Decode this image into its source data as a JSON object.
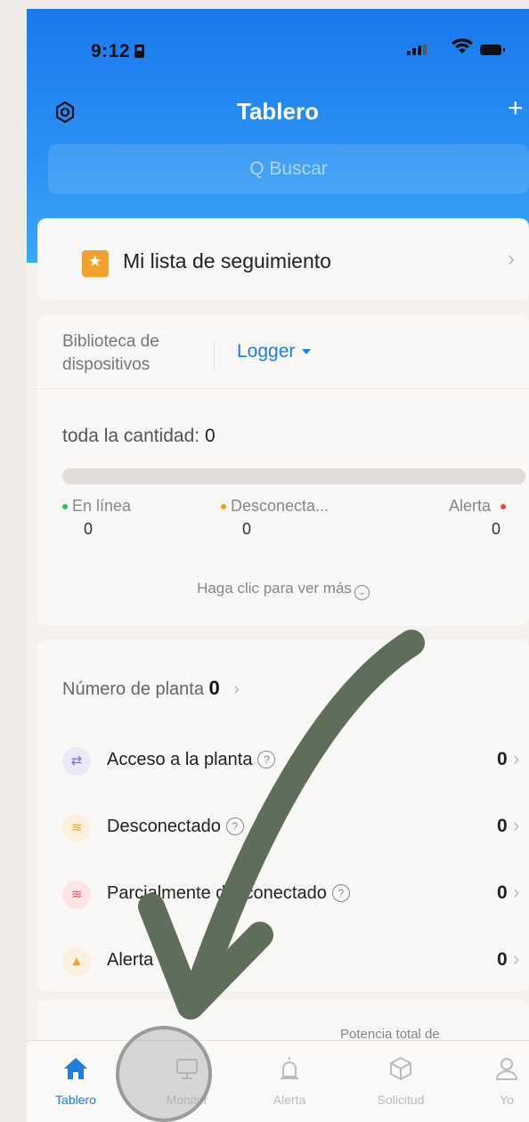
{
  "status_bar": {
    "time": "9:12"
  },
  "header": {
    "title": "Tablero",
    "plus": "+"
  },
  "search": {
    "placeholder": "Q Buscar"
  },
  "watchlist": {
    "label": "Mi lista de seguimiento"
  },
  "devices": {
    "library_label_1": "Biblioteca de",
    "library_label_2": "dispositivos",
    "selected_type": "Logger",
    "total_label": "toda la cantidad:",
    "total_value": "0",
    "online_label": "En línea",
    "online_value": "0",
    "offline_label": "Desconecta...",
    "offline_value": "0",
    "alert_label": "Alerta",
    "alert_value": "0",
    "more_label": "Haga clic para ver más"
  },
  "plants": {
    "count_label": "Número de planta",
    "count_value": "0",
    "rows": [
      {
        "label": "Acceso a la planta",
        "value": "0",
        "icon": "plug-icon",
        "color": "#7a6fd4"
      },
      {
        "label": "Desconectado",
        "value": "0",
        "icon": "wifi-icon",
        "color": "#f2a12e"
      },
      {
        "label": "Parcialmente desconectado",
        "value": "0",
        "icon": "wifi-warning-icon",
        "color": "#ef5a5a"
      },
      {
        "label": "Alerta",
        "value": "0",
        "icon": "siren-icon",
        "color": "#f2a12e"
      }
    ]
  },
  "power": {
    "label": "Potencia total de"
  },
  "tabs": [
    {
      "label": "Tablero",
      "icon": "home-icon",
      "active": true
    },
    {
      "label": "Monitor",
      "icon": "monitor-icon",
      "active": false
    },
    {
      "label": "Alerta",
      "icon": "siren-icon",
      "active": false
    },
    {
      "label": "Solicitud",
      "icon": "cube-icon",
      "active": false
    },
    {
      "label": "Yo",
      "icon": "person-icon",
      "active": false
    }
  ],
  "colors": {
    "header_blue": "#1a79ee",
    "accent_blue": "#1e7de0",
    "online_green": "#22c55e",
    "offline_orange": "#f59e0b",
    "alert_red": "#ef4444",
    "arrow_green": "#5f6e5a"
  }
}
